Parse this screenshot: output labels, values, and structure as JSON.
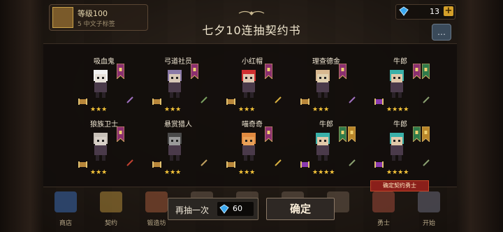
{
  "hud": {
    "player_level": "等级100",
    "player_sub": "5 中文子标签",
    "gems": "13",
    "gem_plus": "+",
    "chat_icon": "chat-bubble-icon"
  },
  "title": "七夕10连抽契约书",
  "cards": [
    {
      "name": "吸血鬼",
      "stars": "★★★",
      "sprite_color": "#e8e2da",
      "hair": "#f2f2f2",
      "banner": "#8b2f6f",
      "banner2": null,
      "weapon": "#a070c0"
    },
    {
      "name": "弓道社员",
      "stars": "★★★",
      "sprite_color": "#d8c8b8",
      "hair": "#8a7aa8",
      "banner": "#8b2f6f",
      "banner2": null,
      "weapon": "#7aa060"
    },
    {
      "name": "小红帽",
      "stars": "★★★",
      "sprite_color": "#e0c8b0",
      "hair": "#d03030",
      "banner": "#8b2f6f",
      "banner2": null,
      "weapon": "#d8b040"
    },
    {
      "name": "理查德金",
      "stars": "★★★",
      "sprite_color": "#e0d0b0",
      "hair": "#d8b890",
      "banner": "#8b2f6f",
      "banner2": null,
      "weapon": "#a070c0"
    },
    {
      "name": "牛郎",
      "stars": "★★★★",
      "sprite_color": "#e0c8a8",
      "hair": "#3ab0a8",
      "banner": "#8b2f6f",
      "banner2": "#2f7a4a",
      "weapon": "#8aa070"
    },
    {
      "name": "狼族卫士",
      "stars": "★★★",
      "sprite_color": "#d8d0c8",
      "hair": "#c8c0b8",
      "banner": "#8b2f6f",
      "banner2": null,
      "weapon": "#c04030"
    },
    {
      "name": "悬赏猎人",
      "stars": "★★★",
      "sprite_color": "#9a9a9a",
      "hair": "#4a4a4a",
      "banner": null,
      "banner2": null,
      "weapon": "#c0a060"
    },
    {
      "name": "喵奇奇",
      "stars": "★★★",
      "sprite_color": "#e8a058",
      "hair": "#e08a40",
      "banner": "#8b2f6f",
      "banner2": null,
      "weapon": "#d8b040"
    },
    {
      "name": "牛郎",
      "stars": "★★★★",
      "sprite_color": "#e0c8a8",
      "hair": "#3ab0a8",
      "banner": "#2f7a4a",
      "banner2": "#b8862a",
      "weapon": "#8aa070"
    },
    {
      "name": "牛郎",
      "stars": "★★★★",
      "sprite_color": "#e0c8a8",
      "hair": "#3ab0a8",
      "banner": "#2f7a4a",
      "banner2": "#b8862a",
      "weapon": "#8aa070"
    }
  ],
  "confirm_tag": "确定契约勇士",
  "nav": [
    {
      "label": "商店",
      "color": "#3a6ab0"
    },
    {
      "label": "契约",
      "color": "#b08a3a"
    },
    {
      "label": "锻造坊",
      "color": "#a05a3a"
    },
    {
      "label": "",
      "color": "#6a5a4a"
    },
    {
      "label": "",
      "color": "#6a5a4a"
    },
    {
      "label": "",
      "color": "#6a5a4a"
    },
    {
      "label": "",
      "color": "#6a5a4a"
    },
    {
      "label": "勇士",
      "color": "#a04a3a"
    },
    {
      "label": "开始",
      "color": "#6a6a7a"
    }
  ],
  "buttons": {
    "redraw_label": "再抽一次",
    "redraw_cost": "60",
    "confirm_label": "确定"
  },
  "colors": {
    "star": "#f6c53a",
    "gem": "#3aa8f0",
    "tag_bg": "#8a1f1a"
  }
}
